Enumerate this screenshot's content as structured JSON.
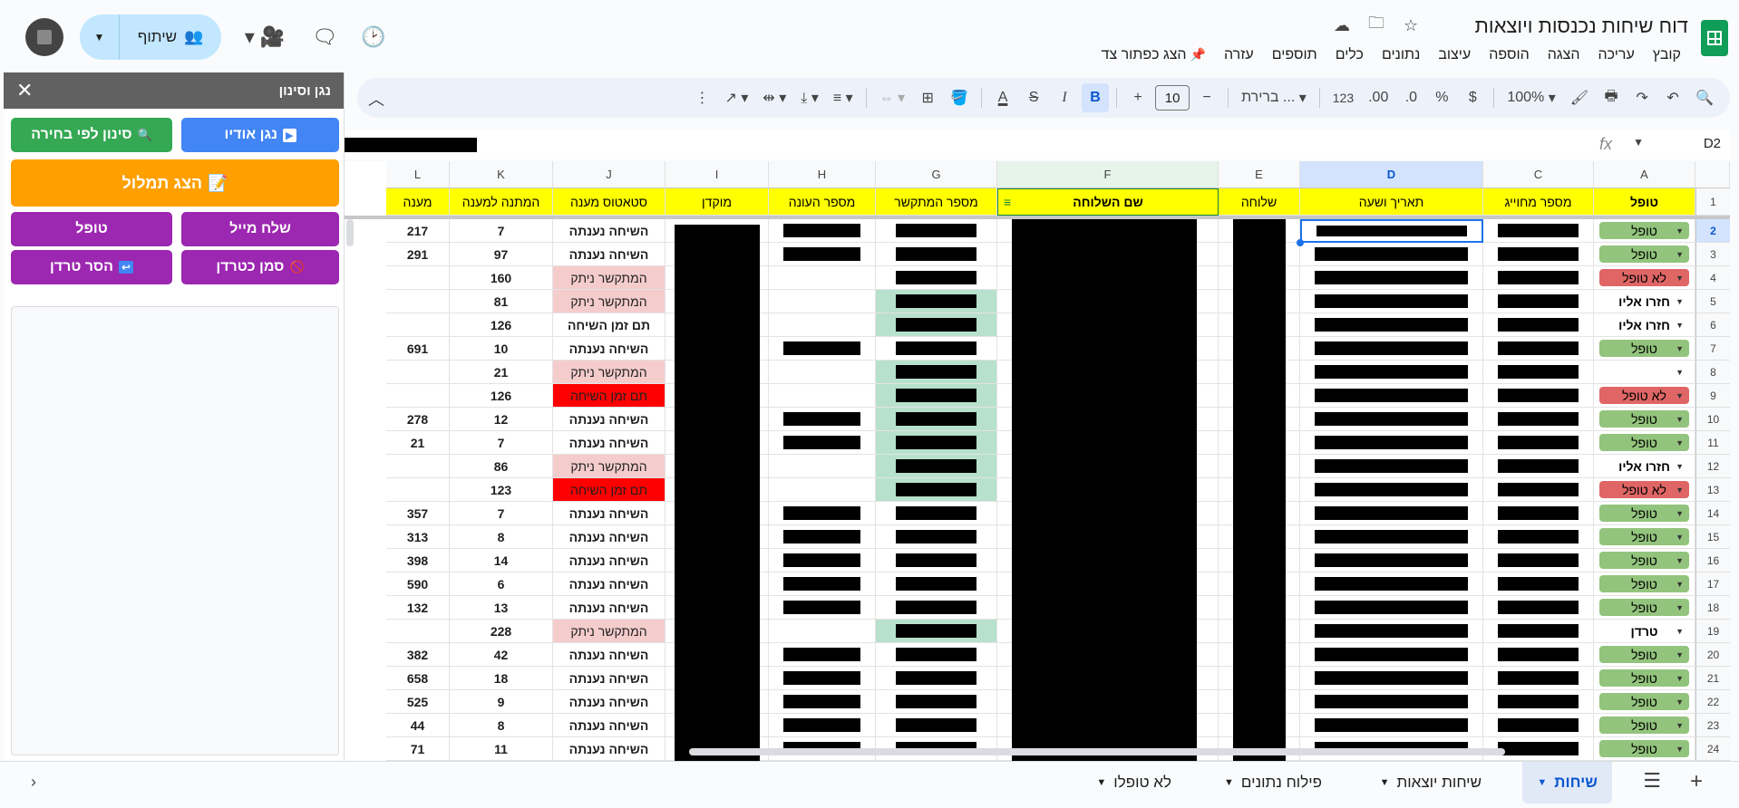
{
  "doc": {
    "title": "דוח שיחות נכנסות ויוצאות",
    "menu": [
      "קובץ",
      "עריכה",
      "הצגה",
      "הוספה",
      "עיצוב",
      "נתונים",
      "כלים",
      "תוספים",
      "עזרה"
    ],
    "pin_label": "הצג כפתור צד"
  },
  "share": {
    "label": "שיתוף"
  },
  "toolbar": {
    "zoom": "100%",
    "currency": "$",
    "percent": "%",
    "dec_less": ".0",
    "dec_more": ".00",
    "format_123": "123",
    "font": "ברירת ...",
    "font_size": "10",
    "minus": "−",
    "plus": "+",
    "bold": "B",
    "italic": "I",
    "text_color": "A"
  },
  "formula": {
    "cell": "D2",
    "fx": "fx"
  },
  "sidebar": {
    "title": "נגן וסינון",
    "btn_audio": "נגן אודיו",
    "btn_filter": "סינון לפי בחירה",
    "btn_transcript": "הצג תמלול",
    "btn_mail": "שלח מייל",
    "btn_handled": "טופל",
    "btn_mark_nuisance": "סמן כטרדן",
    "btn_remove_nuisance": "הסר טרדן",
    "icon_audio": "▶",
    "icon_filter": "🔍",
    "icon_transcript": "📝",
    "icon_mark": "🚫",
    "icon_remove": "↩"
  },
  "columns": [
    "A",
    "C",
    "D",
    "E",
    "F",
    "G",
    "H",
    "I",
    "J",
    "K",
    "L"
  ],
  "header_row": {
    "A": "טופל",
    "C": "מספר מחוייג",
    "D": "תאריך ושעה",
    "E": "שלוחה",
    "F": "שם השלוחה",
    "G": "מספר המתקשר",
    "H": "מספר העונה",
    "I": "מוקדן",
    "J": "סטאטוס מענה",
    "K": "המתנה למענה",
    "L": "מענה"
  },
  "rows": [
    {
      "n": "2",
      "a": "טופל",
      "j": "השיחה נענתה",
      "k": "7",
      "l": "217"
    },
    {
      "n": "3",
      "a": "טופל",
      "j": "השיחה נענתה",
      "k": "97",
      "l": "291"
    },
    {
      "n": "4",
      "a": "לא טופל",
      "j": "המתקשר ניתק",
      "k": "160",
      "l": ""
    },
    {
      "n": "5",
      "a": "חזרו אליו",
      "j": "המתקשר ניתק",
      "k": "81",
      "l": ""
    },
    {
      "n": "6",
      "a": "חזרו אליו",
      "j": "תם זמן השיחה",
      "k": "126",
      "l": ""
    },
    {
      "n": "7",
      "a": "טופל",
      "j": "השיחה נענתה",
      "k": "10",
      "l": "691"
    },
    {
      "n": "8",
      "a": "",
      "j": "המתקשר ניתק",
      "k": "21",
      "l": ""
    },
    {
      "n": "9",
      "a": "לא טופל",
      "j": "תם זמן השיחה",
      "k": "126",
      "l": ""
    },
    {
      "n": "10",
      "a": "טופל",
      "j": "השיחה נענתה",
      "k": "12",
      "l": "278"
    },
    {
      "n": "11",
      "a": "טופל",
      "j": "השיחה נענתה",
      "k": "7",
      "l": "21"
    },
    {
      "n": "12",
      "a": "חזרו אליו",
      "j": "המתקשר ניתק",
      "k": "86",
      "l": ""
    },
    {
      "n": "13",
      "a": "לא טופל",
      "j": "תם זמן השיחה",
      "k": "123",
      "l": ""
    },
    {
      "n": "14",
      "a": "טופל",
      "j": "השיחה נענתה",
      "k": "7",
      "l": "357"
    },
    {
      "n": "15",
      "a": "טופל",
      "j": "השיחה נענתה",
      "k": "8",
      "l": "313"
    },
    {
      "n": "16",
      "a": "טופל",
      "j": "השיחה נענתה",
      "k": "14",
      "l": "398"
    },
    {
      "n": "17",
      "a": "טופל",
      "j": "השיחה נענתה",
      "k": "6",
      "l": "590"
    },
    {
      "n": "18",
      "a": "טופל",
      "j": "השיחה נענתה",
      "k": "13",
      "l": "132"
    },
    {
      "n": "19",
      "a": "טרדן",
      "j": "המתקשר ניתק",
      "k": "228",
      "l": ""
    },
    {
      "n": "20",
      "a": "טופל",
      "j": "השיחה נענתה",
      "k": "42",
      "l": "382"
    },
    {
      "n": "21",
      "a": "טופל",
      "j": "השיחה נענתה",
      "k": "18",
      "l": "658"
    },
    {
      "n": "22",
      "a": "טופל",
      "j": "השיחה נענתה",
      "k": "9",
      "l": "525"
    },
    {
      "n": "23",
      "a": "טופל",
      "j": "השיחה נענתה",
      "k": "8",
      "l": "44"
    },
    {
      "n": "24",
      "a": "טופל",
      "j": "השיחה נענתה",
      "k": "11",
      "l": "71"
    }
  ],
  "status_colors": {
    "handled": "#93c47d",
    "not_handled": "#e06666",
    "hung_up": "#f4cccc",
    "timeout": "#ff0000",
    "caller_green": "#b7e1cd",
    "header_yellow": "#ffff00"
  },
  "tabs": [
    "שיחות",
    "שיחות יוצאות",
    "פילוח נתונים",
    "לא טופלו"
  ],
  "icons": {
    "search": "search-icon",
    "undo": "undo-icon",
    "redo": "redo-icon",
    "print": "print-icon",
    "paint": "paint-format-icon"
  }
}
